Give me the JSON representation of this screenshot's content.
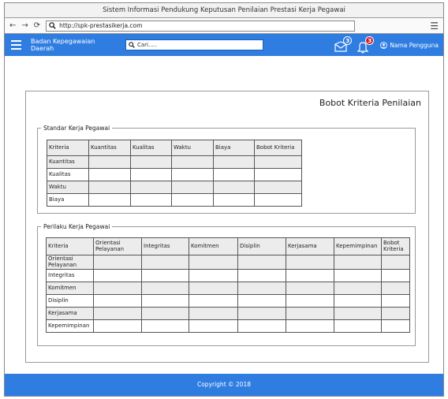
{
  "window": {
    "title": "Sistem Informasi Pendukung Keputusan Penilaian Prestasi Kerja Pegawai"
  },
  "browser": {
    "back": "←",
    "forward": "→",
    "reload": "⟳",
    "url": "http://spk-prestasikerja.com",
    "menu": "☰"
  },
  "header": {
    "brand": "Badan Kepegawaian Daerah",
    "search_placeholder": "Cari.....",
    "messages_count": "3",
    "notifications_count": "3",
    "user_label": "Nama Pengguna",
    "accent_color": "#2f7de1",
    "badge_color": "#d21f2a"
  },
  "panel": {
    "title": "Bobot Kriteria Penilaian"
  },
  "standar": {
    "legend": "Standar Kerja Pegawai",
    "headers": [
      "Kriteria",
      "Kuantitas",
      "Kualitas",
      "Waktu",
      "Biaya",
      "Bobot Kriteria"
    ],
    "rows": [
      "Kuantitas",
      "Kualitas",
      "Waktu",
      "Biaya"
    ]
  },
  "perilaku": {
    "legend": "Perilaku Kerja Pegawai",
    "headers": [
      "Kriteria",
      "Orientasi Pelayanan",
      "Integritas",
      "Komitmen",
      "Disiplin",
      "Kerjasama",
      "Kepemimpinan",
      "Bobot Kriteria"
    ],
    "rows": [
      "Orientasi Pelayanan",
      "Integritas",
      "Komitmen",
      "Disiplin",
      "Kerjasama",
      "Kepemimpinan"
    ]
  },
  "footer": {
    "text": "Copyright © 2018"
  }
}
